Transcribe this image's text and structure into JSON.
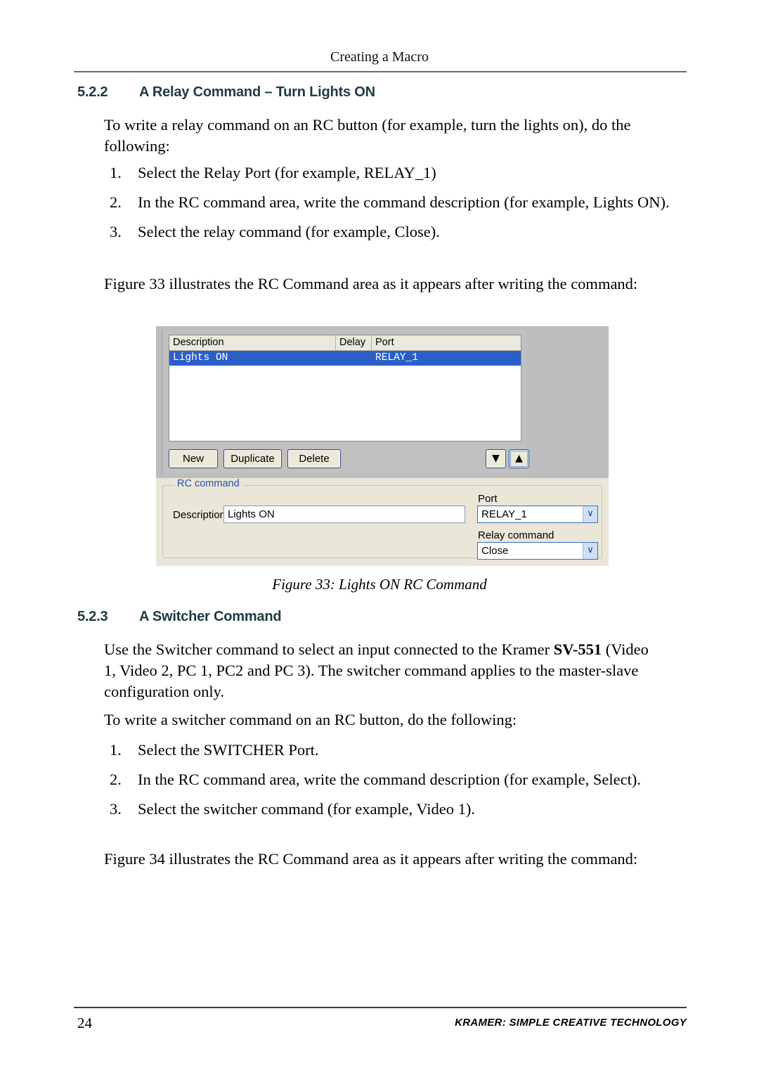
{
  "header": {
    "running_title": "Creating a Macro"
  },
  "sections": {
    "relay": {
      "number": "5.2.2",
      "title": "A Relay Command – Turn Lights ON",
      "intro": "To write a relay command on an RC button (for example, turn the lights on), do the following:",
      "steps": [
        {
          "marker": "1.",
          "text": "Select the Relay Port (for example, RELAY_1)"
        },
        {
          "marker": "2.",
          "text": "In the RC command area, write the command description (for example, Lights ON)."
        },
        {
          "marker": "3.",
          "text": "Select the relay command (for example, Close)."
        }
      ],
      "figure_lead": "Figure 33 illustrates the RC Command area as it appears after writing the command:"
    },
    "switcher": {
      "number": "5.2.3",
      "title": "A Switcher Command",
      "intro_part1": "Use the Switcher command to select an input connected to the Kramer ",
      "intro_bold": "SV-551",
      "intro_part2": " (Video 1, Video 2, PC 1, PC2 and PC 3). The switcher command applies to the master-slave configuration only.",
      "lead": "To write a switcher command on an RC button, do the following:",
      "steps": [
        {
          "marker": "1.",
          "text": "Select the SWITCHER Port."
        },
        {
          "marker": "2.",
          "text": "In the RC command area, write the command description (for example, Select)."
        },
        {
          "marker": "3.",
          "text": "Select the switcher command (for example, Video 1)."
        }
      ],
      "figure_lead": "Figure 34 illustrates the RC Command area as it appears after writing the command:"
    }
  },
  "figure": {
    "caption": "Figure 33: Lights ON RC Command",
    "list_view": {
      "columns": [
        "Description",
        "Delay",
        "Port"
      ],
      "rows": [
        {
          "description": "Lights ON",
          "delay": "",
          "port": "RELAY_1",
          "selected": true
        }
      ]
    },
    "buttons": {
      "new": "New",
      "duplicate": "Duplicate",
      "delete": "Delete",
      "move_down_icon": "▼",
      "move_up_icon": "▲"
    },
    "rc_command": {
      "group_label": "RC command",
      "description_label": "Description",
      "description_value": "Lights ON",
      "port_label": "Port",
      "port_value": "RELAY_1",
      "relay_command_label": "Relay command",
      "relay_command_value": "Close",
      "dropdown_icon": "∨"
    }
  },
  "footer": {
    "page_number": "24",
    "tagline": "KRAMER:  SIMPLE CREATIVE TECHNOLOGY"
  },
  "colors": {
    "heading": "#1e3a42",
    "selection_blue": "#2a5fc8",
    "panel_gray": "#bdbdbd",
    "panel_beige": "#eae6d8",
    "legend_blue": "#2554b0"
  }
}
